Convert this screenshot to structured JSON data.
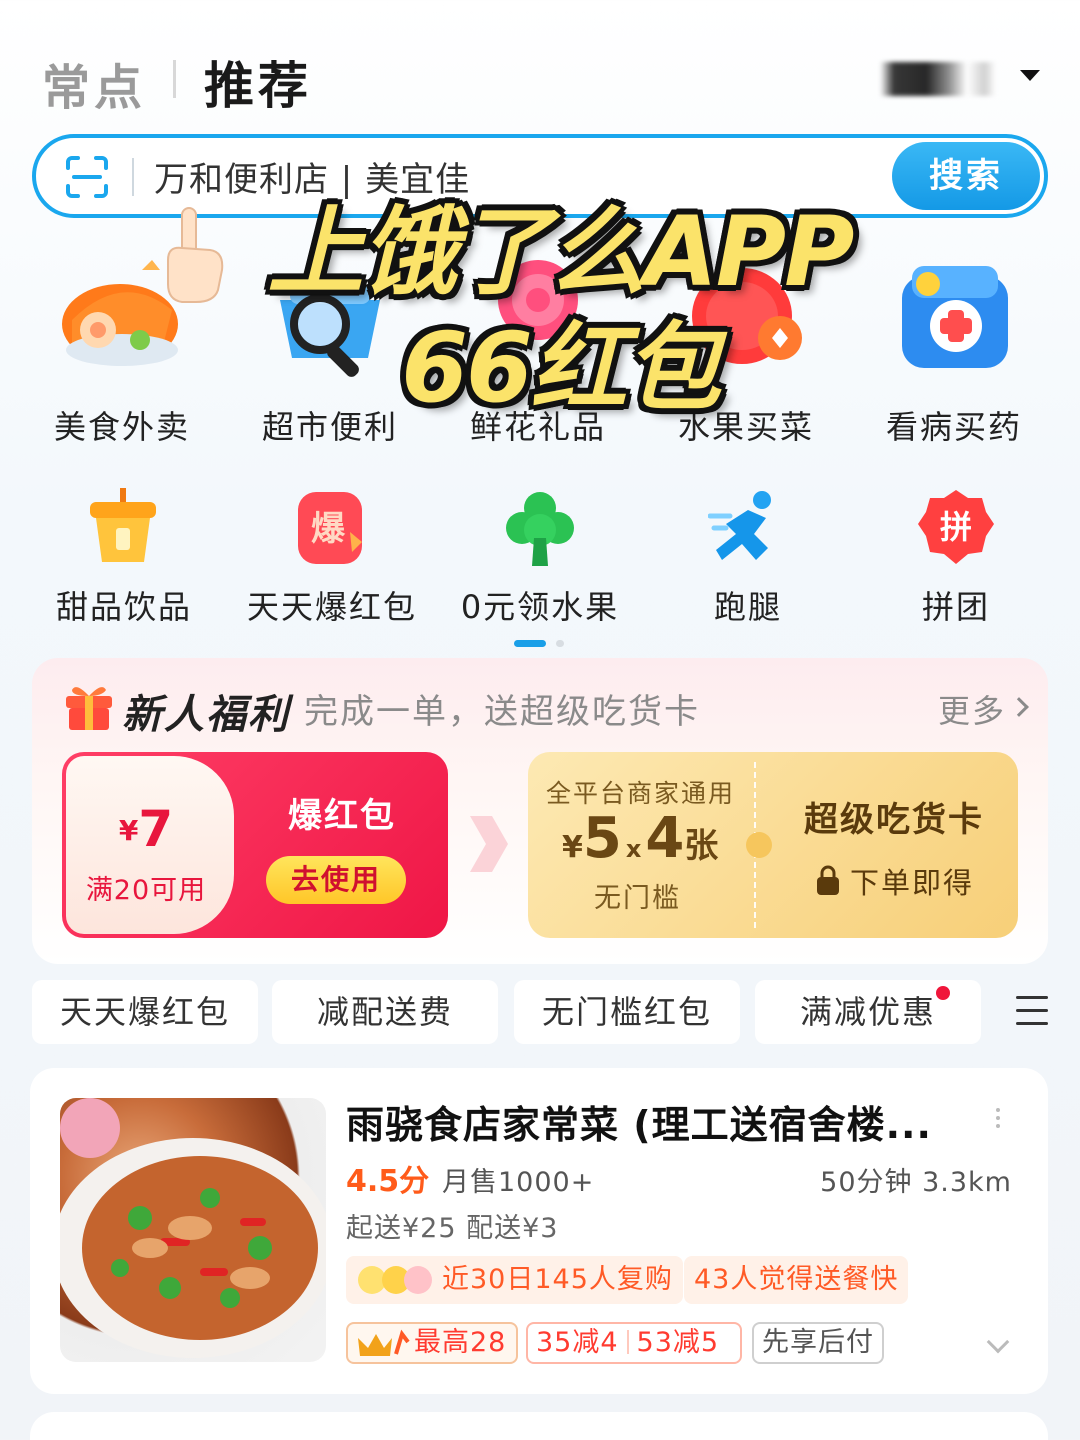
{
  "header": {
    "tab_changdian": "常点",
    "tab_tuijian": "推荐"
  },
  "search": {
    "placeholder": "万和便利店 | 美宜佳",
    "button": "搜索"
  },
  "overlay": {
    "line1": "上饿了么APP",
    "line2": "66红包"
  },
  "categories_row1": [
    {
      "label": "美食外卖",
      "icon": "food-delivery-icon"
    },
    {
      "label": "超市便利",
      "icon": "supermarket-basket-icon"
    },
    {
      "label": "鲜花礼品",
      "icon": "flower-icon"
    },
    {
      "label": "水果买菜",
      "icon": "strawberry-icon"
    },
    {
      "label": "看病买药",
      "icon": "medicine-kit-icon"
    }
  ],
  "categories_row2": [
    {
      "label": "甜品饮品",
      "icon": "drink-cup-icon"
    },
    {
      "label": "天天爆红包",
      "icon": "bao-badge-icon"
    },
    {
      "label": "0元领水果",
      "icon": "tree-icon"
    },
    {
      "label": "跑腿",
      "icon": "runner-icon"
    },
    {
      "label": "拼团",
      "icon": "pin-badge-icon"
    }
  ],
  "newcomer": {
    "title": "新人福利",
    "subtitle": "完成一单，送超级吃货卡",
    "more": "更多",
    "red_coupon": {
      "currency": "¥",
      "amount": "7",
      "condition": "满20可用",
      "name": "爆红包",
      "action": "去使用"
    },
    "gold_card": {
      "label": "全平台商家通用",
      "currency": "¥",
      "amount": "5",
      "times": "x",
      "count": "4",
      "unit": "张",
      "no_threshold": "无门槛",
      "title": "超级吃货卡",
      "get": "下单即得"
    }
  },
  "filters": [
    "天天爆红包",
    "减配送费",
    "无门槛红包",
    "满减优惠"
  ],
  "shop": {
    "name": "雨骁食店家常菜 (理工送宿舍楼...",
    "rating": "4.5分",
    "sales": "月售1000+",
    "time_distance": "50分钟  3.3km",
    "min_delivery": "起送¥25   配送¥3",
    "tag_repurchase": "近30日145人复购",
    "tag_fast": "43人觉得送餐快",
    "promo_max": "最高28",
    "promo_1": "35减4",
    "promo_2": "53减5",
    "promo_pay_later": "先享后付"
  },
  "colors": {
    "accent_blue": "#1aa7ee",
    "coupon_red": "#ef1646",
    "gold": "#f7cf78",
    "price_orange": "#ff5b1a"
  }
}
